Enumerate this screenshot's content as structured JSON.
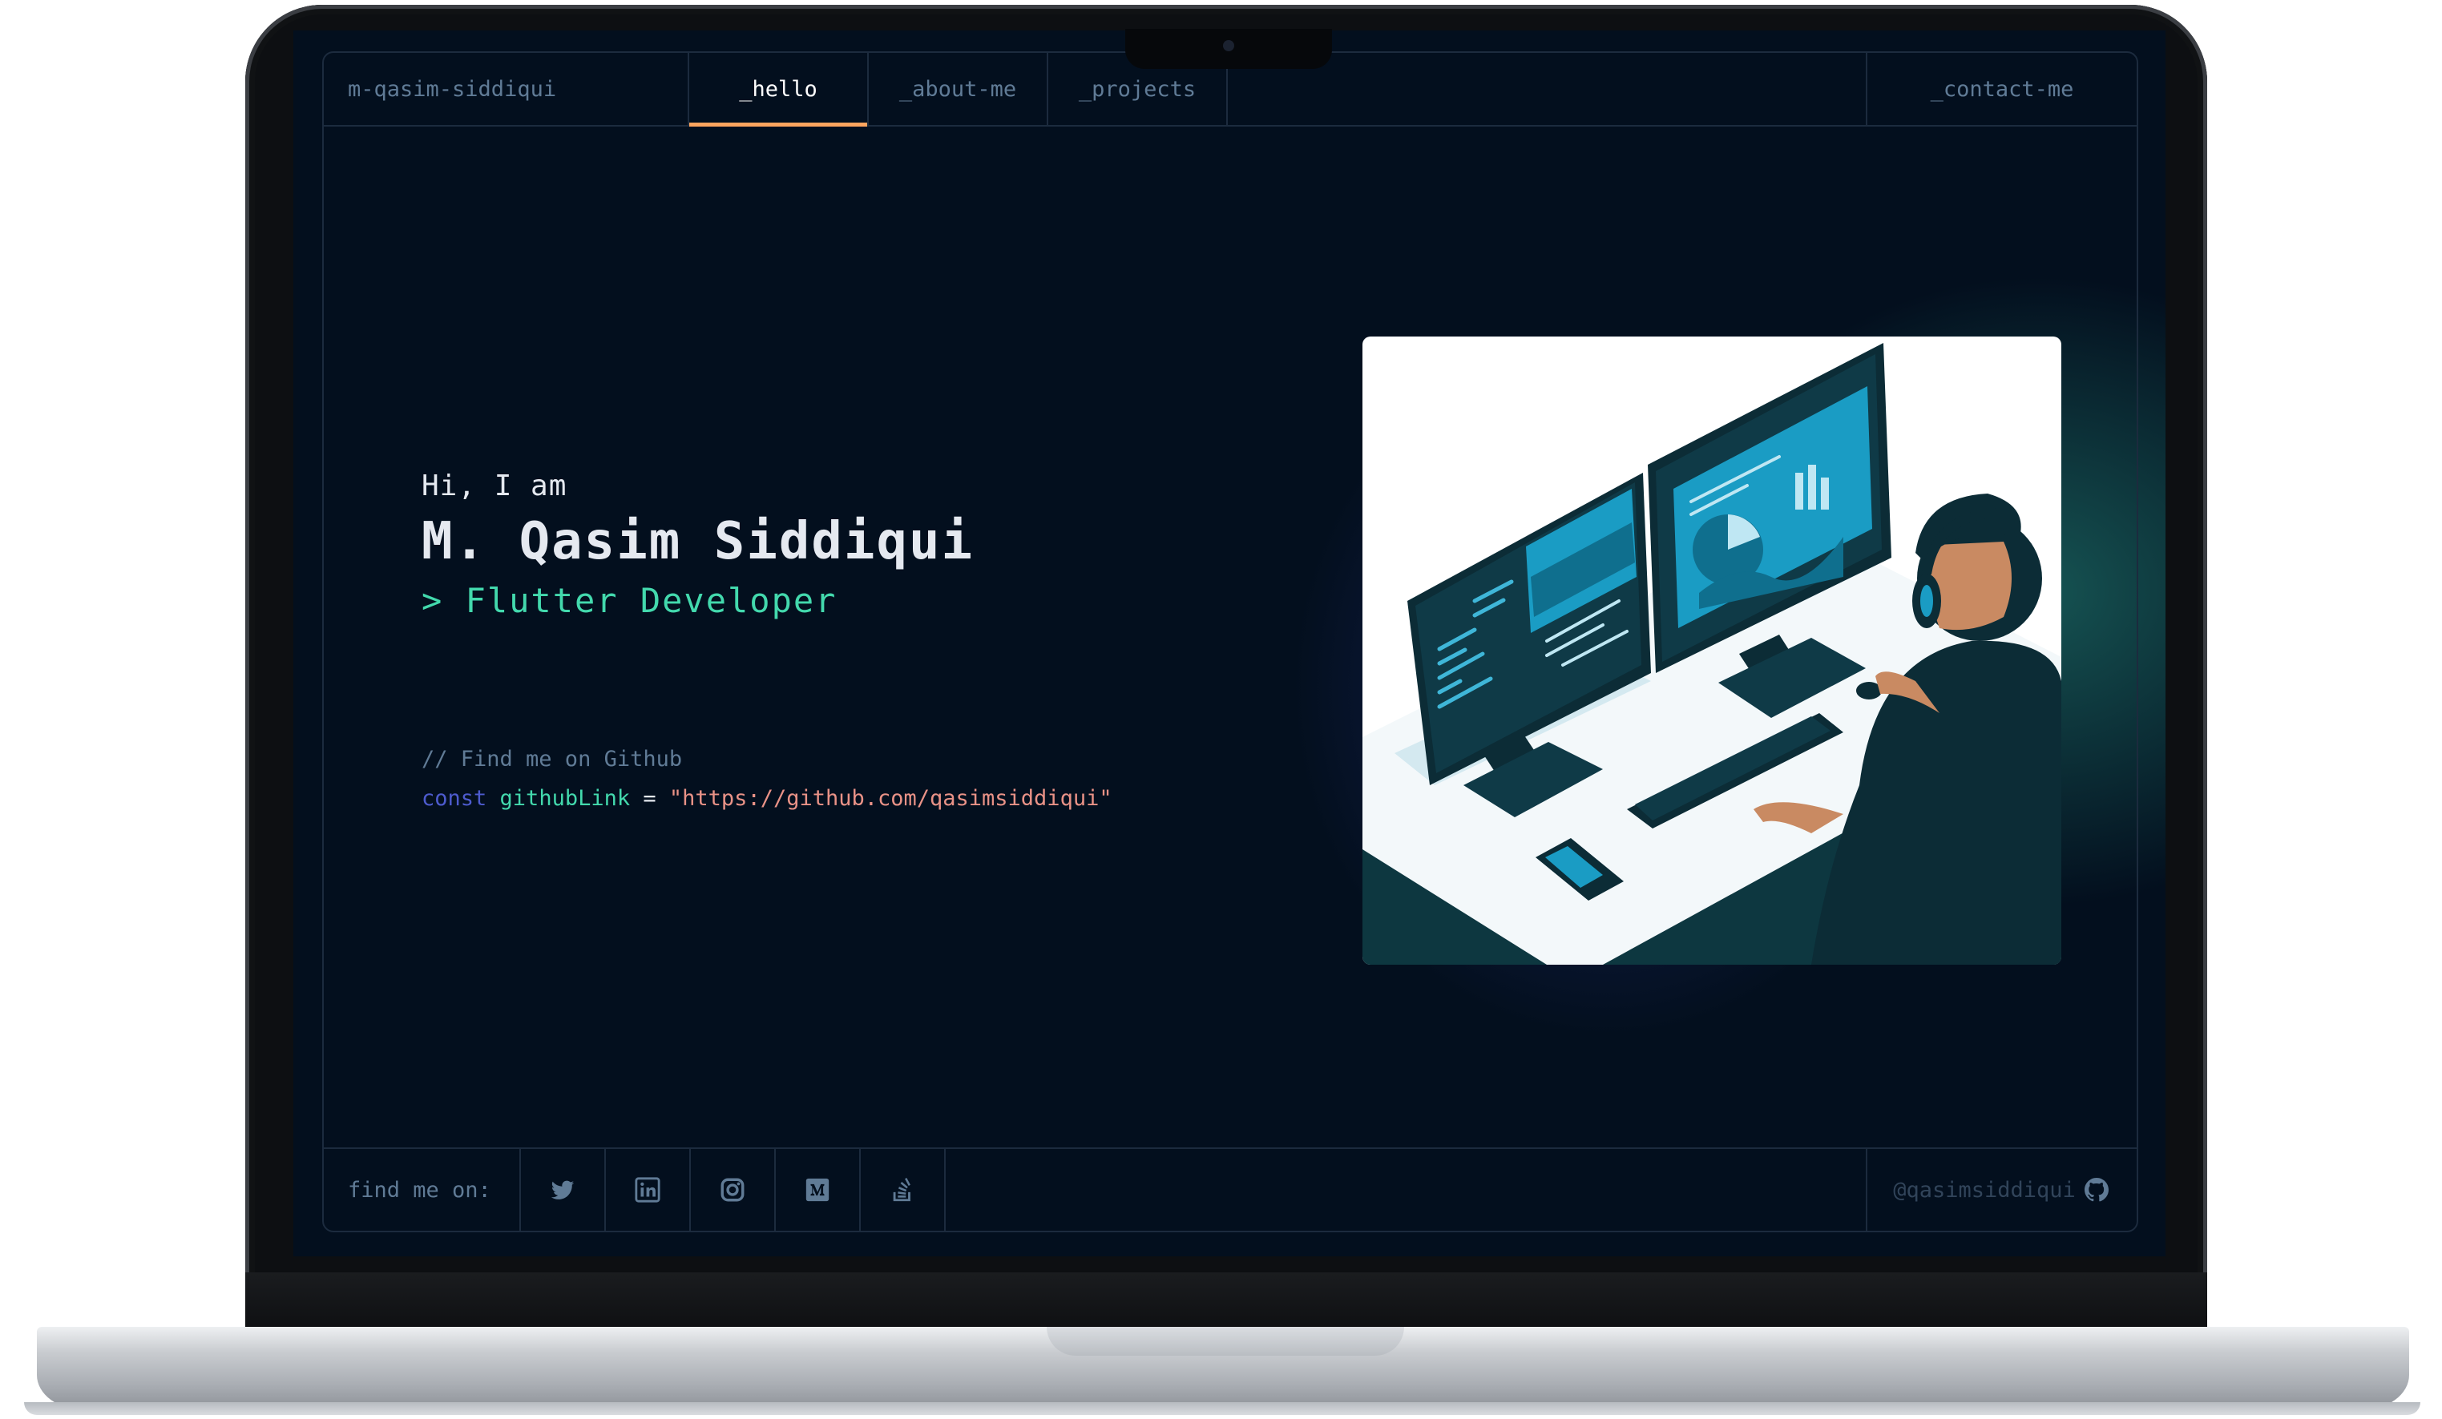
{
  "header": {
    "logo": "m-qasim-siddiqui",
    "tabs": [
      {
        "label": "_hello",
        "active": true
      },
      {
        "label": "_about-me",
        "active": false
      },
      {
        "label": "_projects",
        "active": false
      }
    ],
    "contact": "_contact-me",
    "accent_color": "#fea55f"
  },
  "hero": {
    "greeting": "Hi, I am",
    "name": "M. Qasim Siddiqui",
    "role": "> Flutter Developer"
  },
  "code": {
    "comment": "// Find me on Github",
    "keyword": "const",
    "variable": "githubLink",
    "operator": "=",
    "value": "\"https://github.com/qasimsiddiqui\""
  },
  "illustration": {
    "icon": "developer-at-workstation-illustration"
  },
  "footer": {
    "label": "find me on:",
    "socials": [
      "twitter-icon",
      "linkedin-icon",
      "instagram-icon",
      "medium-icon",
      "stackoverflow-icon"
    ],
    "github_handle": "@qasimsiddiqui"
  },
  "colors": {
    "background": "#030f1e",
    "border": "#1c2b3e",
    "text_muted": "#607b96",
    "accent_green": "#43d9ad",
    "keyword_blue": "#4d5bce",
    "string_red": "#e99287"
  }
}
